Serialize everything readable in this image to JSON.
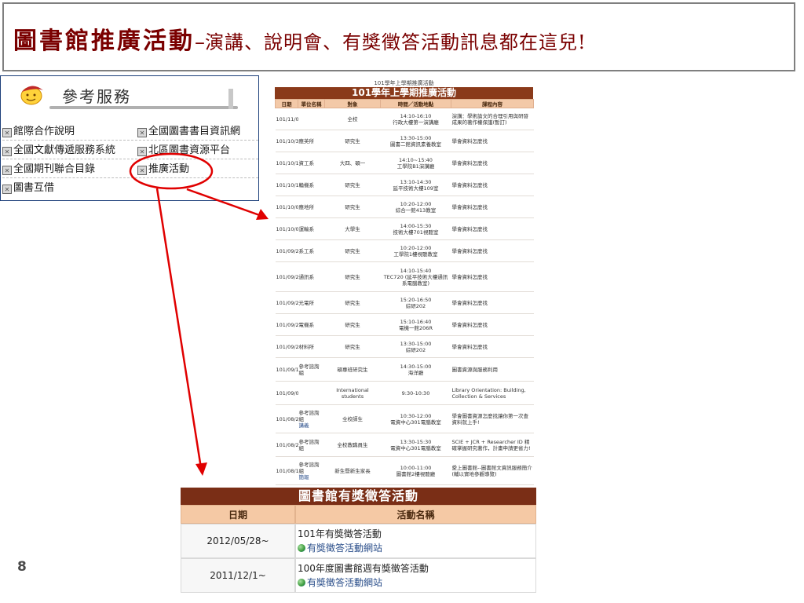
{
  "slide": {
    "title_main": "圖書館推廣活動",
    "title_dash": "–",
    "title_sub": "演講、說明會、有獎徵答活動訊息都在這兒!",
    "page_number": "8"
  },
  "services": {
    "banner": "參考服務",
    "links": [
      {
        "label": "館際合作說明"
      },
      {
        "label": "全國圖書書目資訊網"
      },
      {
        "label": "全國文獻傳遞服務系統"
      },
      {
        "label": "北區圖書資源平台"
      },
      {
        "label": "全國期刊聯合目錄"
      },
      {
        "label": "推廣活動"
      },
      {
        "label": "圖書互借"
      }
    ]
  },
  "schedule": {
    "caption": "101學年上學期推廣活動",
    "title": "101學年上學期推廣活動",
    "headers": [
      "日期",
      "單位名稱",
      "對象",
      "時間／活動地點",
      "課程內容"
    ],
    "rows": [
      {
        "date": "101/11/01",
        "unit": "",
        "audience": "全校",
        "time": "14:10-16:10",
        "place": "行政大樓第一演講廳",
        "content": "演講：學術論文的合理引用與研發成果的著作權保護(暫訂)"
      },
      {
        "date": "101/10/31",
        "unit": "應英所",
        "audience": "研究生",
        "time": "13:30-15:00",
        "place": "圖書二館資訊素養教室",
        "content": "學會資料怎麼找"
      },
      {
        "date": "101/10/18",
        "unit": "資工系",
        "audience": "大四、碩一",
        "time": "14:10~15:40",
        "place": "工學院B1演講廳",
        "content": "學會資料怎麼找"
      },
      {
        "date": "101/10/11",
        "unit": "輪機系",
        "audience": "研究生",
        "time": "13:10-14:30",
        "place": "延平技術大樓109室",
        "content": "學會資料怎麼找"
      },
      {
        "date": "101/10/05",
        "unit": "應地所",
        "audience": "研究生",
        "time": "10:20-12:00",
        "place": "綜合一館413教室",
        "content": "學會資料怎麼找"
      },
      {
        "date": "101/10/04",
        "unit": "運輸系",
        "audience": "大學生",
        "time": "14:00-15:30",
        "place": "技術大樓701視聽室",
        "content": "學會資料怎麼找"
      },
      {
        "date": "101/09/28",
        "unit": "系工系",
        "audience": "研究生",
        "time": "10:20-12:00",
        "place": "工學院1樓視聽教室",
        "content": "學會資料怎麼找"
      },
      {
        "date": "101/09/27",
        "unit": "通訊系",
        "audience": "研究生",
        "time": "14:10-15:40",
        "place": "TEC720 (延平技術大樓通訊系電腦教室)",
        "content": "學會資料怎麼找"
      },
      {
        "date": "101/09/27",
        "unit": "光電所",
        "audience": "研究生",
        "time": "15:20-16:50",
        "place": "綜研202",
        "content": "學會資料怎麼找"
      },
      {
        "date": "101/09/25",
        "unit": "電機系",
        "audience": "研究生",
        "time": "15:10-16:40",
        "place": "電機一館206R",
        "content": "學會資料怎麼找"
      },
      {
        "date": "101/09/24",
        "unit": "材料所",
        "audience": "研究生",
        "time": "13:30-15:00",
        "place": "綜研202",
        "content": "學會資料怎麼找"
      },
      {
        "date": "101/09/10",
        "unit": "參考諮詢組",
        "audience": "碩專班研究生",
        "time": "14:30-15:00",
        "place": "海洋廳",
        "content": "圖書資源與服務利用"
      },
      {
        "date": "101/09/05",
        "unit": "",
        "audience": "International students",
        "time": "9:30-10:30",
        "place": "",
        "content": "Library Orientation: Building, Collection & Services"
      },
      {
        "date": "101/08/28",
        "unit": "參考諮詢組",
        "unit_note": "講義",
        "audience": "全校師生",
        "time": "10:30-12:00",
        "place": "電資中心301電腦教室",
        "content": "學會圖書資源怎麼找讓你第一次查資料就上手!"
      },
      {
        "date": "101/08/28",
        "unit": "參考諮詢組",
        "audience": "全校教職員生",
        "time": "13:30-15:30",
        "place": "電資中心301電腦教室",
        "content": "SCIE + JCR + Researcher ID 精確掌握研究著作，計畫申請更省力!"
      },
      {
        "date": "101/08/18",
        "unit": "參考諮詢組",
        "unit_note": "簡報",
        "audience": "新生暨新生家長",
        "time": "10:00-11:00",
        "place": "圖書館2樓視聽廳",
        "content": "愛上圖書館--圖書館文資訊服務簡介(輔以實地參觀導覽)"
      }
    ]
  },
  "contest": {
    "title": "圖書館有獎徵答活動",
    "headers": [
      "日期",
      "活動名稱"
    ],
    "rows": [
      {
        "date": "2012/05/28~",
        "name": "101年有獎徵答活動",
        "link": "有獎徵答活動網站"
      },
      {
        "date": "2011/12/1~",
        "name": "100年度圖書館週有獎徵答活動",
        "link": "有獎徵答活動網站"
      }
    ]
  },
  "colors": {
    "title_text": "#7a0000",
    "arrow": "#e00000",
    "schedule_header": "#8a3a1a",
    "table_header_bg": "#f3c9a8",
    "contest_header": "#7a2e16"
  }
}
